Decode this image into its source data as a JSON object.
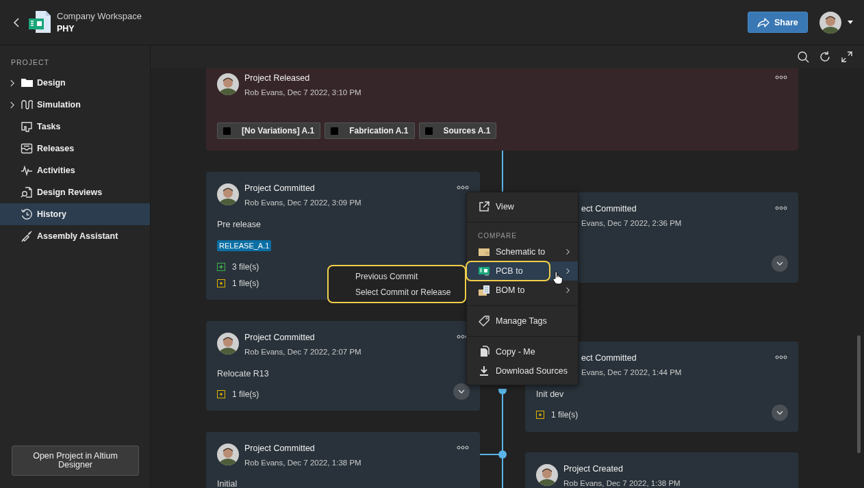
{
  "header": {
    "workspace": "Company Workspace",
    "project": "PHY",
    "share_label": "Share"
  },
  "sidebar": {
    "heading": "PROJECT",
    "items": [
      {
        "label": "Design",
        "expandable": true,
        "selected": false
      },
      {
        "label": "Simulation",
        "expandable": true,
        "selected": false
      },
      {
        "label": "Tasks",
        "expandable": false,
        "selected": false
      },
      {
        "label": "Releases",
        "expandable": false,
        "selected": false
      },
      {
        "label": "Activities",
        "expandable": false,
        "selected": false
      },
      {
        "label": "Design Reviews",
        "expandable": false,
        "selected": false
      },
      {
        "label": "History",
        "expandable": false,
        "selected": true
      },
      {
        "label": "Assembly Assistant",
        "expandable": false,
        "selected": false
      }
    ],
    "open_button": "Open Project in Altium Designer"
  },
  "timeline": {
    "events": [
      {
        "kind": "released",
        "avatar": true,
        "title": "Project Released",
        "meta": "Rob Evans, Dec 7 2022, 3:10 PM",
        "more": true,
        "expand": false,
        "artifacts": [
          "[No Variations] A.1",
          "Fabrication A.1",
          "Sources A.1"
        ]
      },
      {
        "kind": "commit",
        "avatar": true,
        "title": "Project Committed",
        "meta": "Rob Evans, Dec 7 2022, 3:09 PM",
        "more": true,
        "expand": false,
        "message": "Pre release",
        "tags": [
          "RELEASE_A.1"
        ],
        "files": [
          {
            "kind": "added",
            "text": "3 file(s)"
          },
          {
            "kind": "modified",
            "text": "1 file(s)"
          }
        ]
      },
      {
        "kind": "commit",
        "avatar": false,
        "title": "ect Committed",
        "meta": "Evans, Dec 7 2022, 2:36 PM",
        "more": true,
        "expand": true
      },
      {
        "kind": "commit",
        "avatar": true,
        "title": "Project Committed",
        "meta": "Rob Evans, Dec 7 2022, 2:07 PM",
        "more": true,
        "expand": true,
        "message": "Relocate R13",
        "files": [
          {
            "kind": "modified",
            "text": "1 file(s)"
          }
        ]
      },
      {
        "kind": "commit",
        "avatar": false,
        "title": "ect Committed",
        "meta": "Evans, Dec 7 2022, 1:44 PM",
        "more": true,
        "expand": true,
        "message": "Init dev",
        "files": [
          {
            "kind": "modified",
            "text": "1 file(s)"
          }
        ]
      },
      {
        "kind": "commit",
        "avatar": true,
        "title": "Project Committed",
        "meta": "Rob Evans, Dec 7 2022, 1:38 PM",
        "more": true,
        "expand": false,
        "message": "Initial"
      },
      {
        "kind": "created",
        "avatar": true,
        "title": "Project Created",
        "meta": "Rob Evans, Dec 7 2022, 1:38 PM",
        "more": false,
        "expand": false
      }
    ]
  },
  "context_menu": {
    "items": [
      {
        "kind": "item",
        "label": "View",
        "submenu": false,
        "selected": false
      },
      {
        "kind": "divider"
      },
      {
        "kind": "heading",
        "label": "COMPARE"
      },
      {
        "kind": "item",
        "label": "Schematic to",
        "submenu": true,
        "selected": false
      },
      {
        "kind": "item",
        "label": "PCB to",
        "submenu": true,
        "selected": true
      },
      {
        "kind": "item",
        "label": "BOM to",
        "submenu": true,
        "selected": false
      },
      {
        "kind": "divider"
      },
      {
        "kind": "item",
        "label": "Manage Tags",
        "submenu": false,
        "selected": false
      },
      {
        "kind": "divider"
      },
      {
        "kind": "item",
        "label": "Copy - Me",
        "submenu": false,
        "selected": false
      },
      {
        "kind": "item",
        "label": "Download Sources",
        "submenu": false,
        "selected": false
      }
    ]
  },
  "submenu": {
    "items": [
      "Previous Commit",
      "Select Commit or Release"
    ]
  }
}
